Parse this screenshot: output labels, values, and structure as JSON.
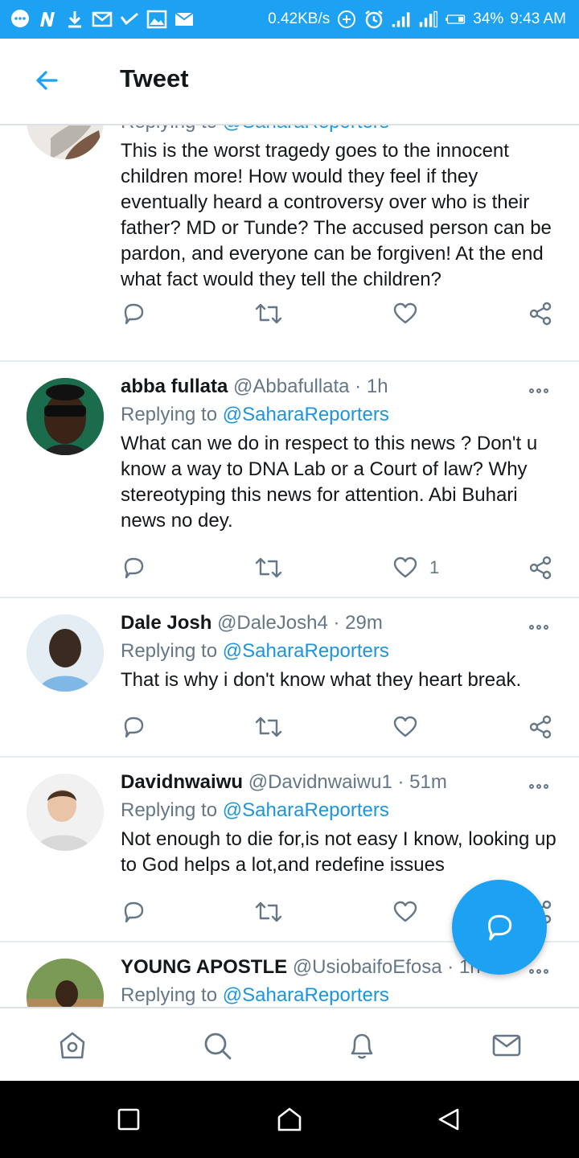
{
  "status_bar": {
    "speed": "0.42KB/s",
    "battery": "34%",
    "time": "9:43 AM",
    "icons_left": [
      "chat-bubble-icon",
      "n-app-icon",
      "download-icon",
      "gmail-icon",
      "check-icon",
      "image-icon",
      "mail-off-icon"
    ],
    "icons_right": [
      "hotspot-icon",
      "alarm-icon",
      "signal-icon",
      "signal-icon-2",
      "battery-icon"
    ]
  },
  "header": {
    "title": "Tweet"
  },
  "tweets": [
    {
      "replying_prefix": "Replying to",
      "replying_handle": "@SaharaReporters",
      "text": "This is the worst tragedy goes to the innocent children more! How would they feel if they eventually heard a controversy over who is their father? MD or Tunde? The accused person can be pardon, and everyone can be forgiven! At the end what fact would they tell the children?",
      "likes": ""
    },
    {
      "name": "abba fullata",
      "handle": "@Abbafullata",
      "sep": "·",
      "time": "1h",
      "replying_prefix": "Replying to",
      "replying_handle": "@SaharaReporters",
      "text": "What can we do in respect to this news ? Don't u know a way to DNA Lab or a Court of law? Why stereotyping this news for attention. Abi Buhari news no dey.",
      "likes": "1"
    },
    {
      "name": "Dale Josh",
      "handle": "@DaleJosh4",
      "sep": "·",
      "time": "29m",
      "replying_prefix": "Replying to",
      "replying_handle": "@SaharaReporters",
      "text": "That is why i don't know what they heart break.",
      "likes": ""
    },
    {
      "name": "Davidnwaiwu",
      "handle": "@Davidnwaiwu1",
      "sep": "·",
      "time": "51m",
      "replying_prefix": "Replying to",
      "replying_handle": "@SaharaReporters",
      "text": "Not enough to die for,is not easy I know, looking up to God helps a lot,and redefine issues",
      "likes": ""
    },
    {
      "name": "YOUNG APOSTLE",
      "handle": "@UsiobaifoEfosa",
      "sep": "·",
      "time": "1h",
      "replying_prefix": "Replying to",
      "replying_handle": "@SaharaReporters"
    }
  ],
  "tabs": [
    "home-icon",
    "search-icon",
    "notifications-icon",
    "messages-icon"
  ],
  "nav": [
    "recents-button",
    "home-button",
    "back-button"
  ]
}
